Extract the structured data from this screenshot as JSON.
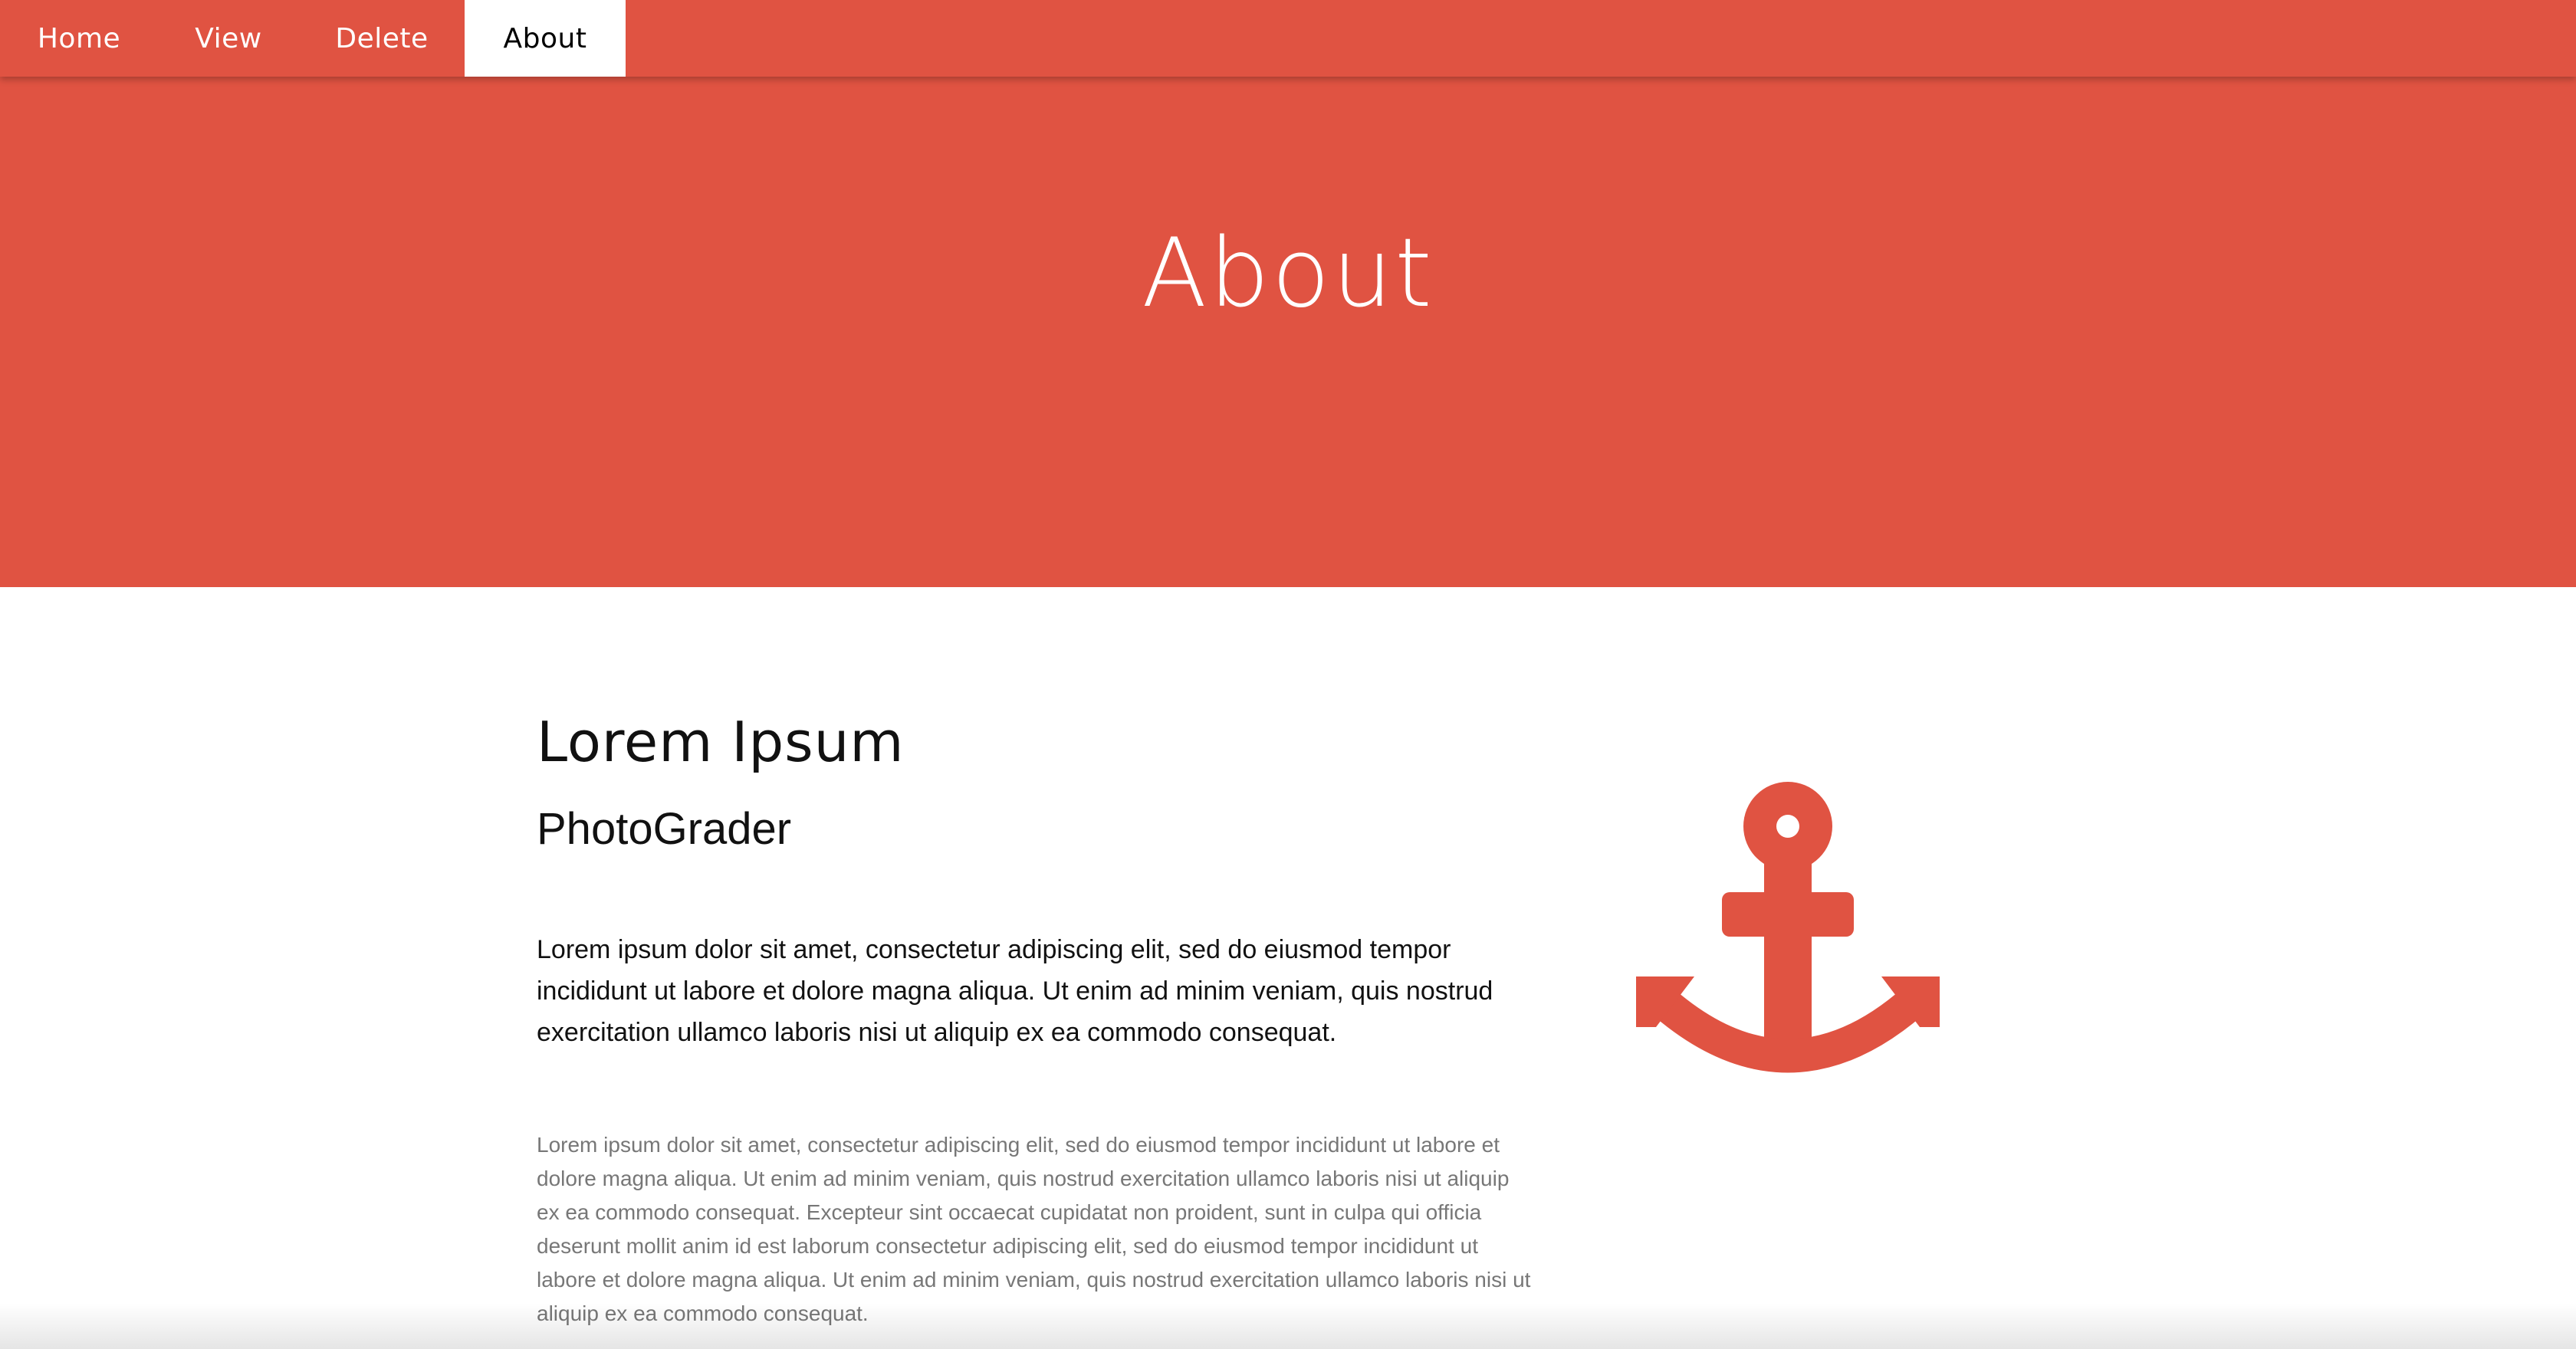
{
  "nav": {
    "items": [
      {
        "label": "Home",
        "active": false
      },
      {
        "label": "View",
        "active": false
      },
      {
        "label": "Delete",
        "active": false
      },
      {
        "label": "About",
        "active": true
      }
    ]
  },
  "hero": {
    "title": "About"
  },
  "content": {
    "heading": "Lorem Ipsum",
    "subheading": "PhotoGrader",
    "lead": "Lorem ipsum dolor sit amet, consectetur adipiscing elit, sed do eiusmod tempor incididunt ut labore et dolore magna aliqua. Ut enim ad minim veniam, quis nostrud exercitation ullamco laboris nisi ut aliquip ex ea commodo consequat.",
    "body": "Lorem ipsum dolor sit amet, consectetur adipiscing elit, sed do eiusmod tempor incididunt ut labore et dolore magna aliqua. Ut enim ad minim veniam, quis nostrud exercitation ullamco laboris nisi ut aliquip ex ea commodo consequat. Excepteur sint occaecat cupidatat non proident, sunt in culpa qui officia deserunt mollit anim id est laborum consectetur adipiscing elit, sed do eiusmod tempor incididunt ut labore et dolore magna aliqua. Ut enim ad minim veniam, quis nostrud exercitation ullamco laboris nisi ut aliquip ex ea commodo consequat."
  },
  "icons": {
    "feature": "anchor-icon"
  },
  "colors": {
    "accent": "#e05342",
    "nav_active_bg": "#ffffff",
    "body_text": "#777777"
  }
}
